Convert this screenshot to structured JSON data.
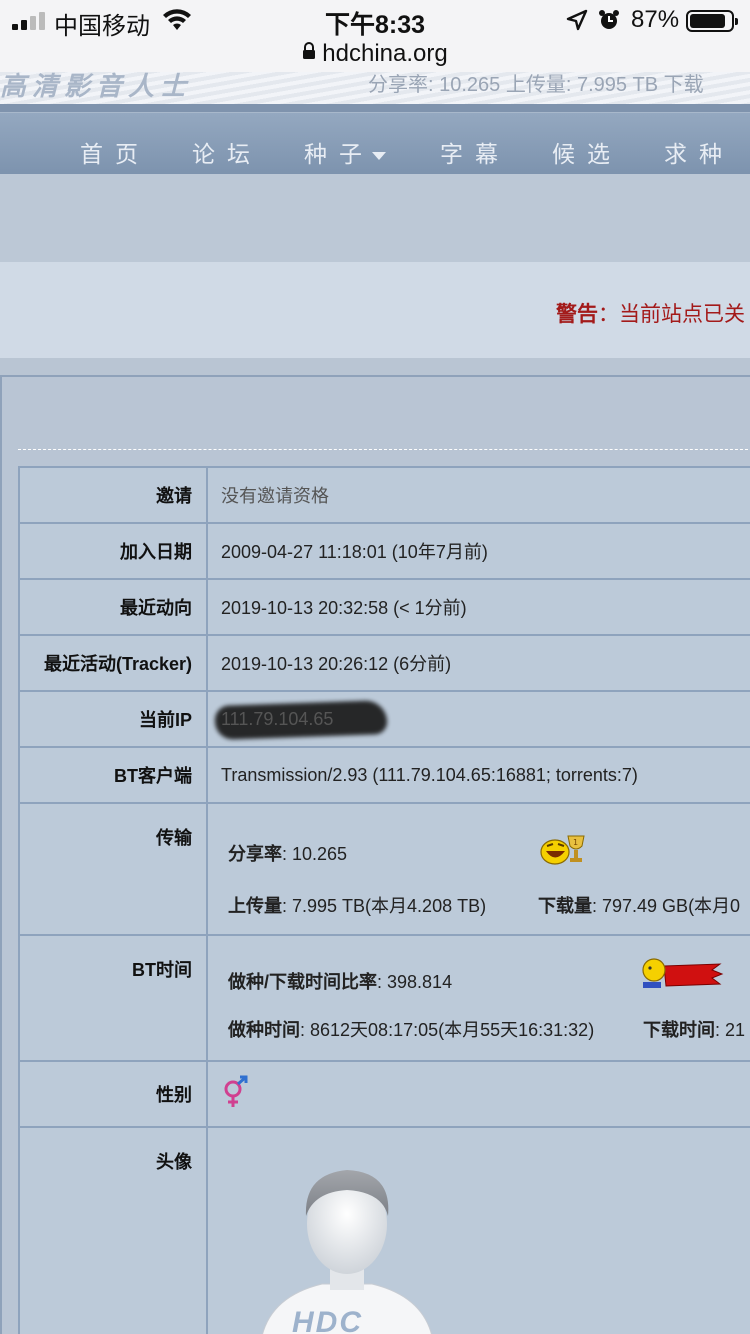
{
  "status_bar": {
    "carrier": "中国移动",
    "time": "下午8:33",
    "battery": "87%",
    "battery_level": 0.87
  },
  "browser": {
    "url": "hdchina.org"
  },
  "banner": {
    "logo_fragment": "高清影音人士",
    "stats_fragment": "分享率: 10.265    上传量: 7.995 TB    下载"
  },
  "nav": {
    "items": [
      {
        "label": "首页"
      },
      {
        "label": "论坛"
      },
      {
        "label": "种子",
        "has_dropdown": true
      },
      {
        "label": "字幕"
      },
      {
        "label": "候选"
      },
      {
        "label": "求种"
      }
    ]
  },
  "notice": {
    "prefix": "警告",
    "text": "：当前站点已关"
  },
  "profile": {
    "rows": [
      {
        "label": "邀请",
        "value": "没有邀请资格"
      },
      {
        "label": "加入日期",
        "value": "2009-04-27 11:18:01 (10年7月前)"
      },
      {
        "label": "最近动向",
        "value": "2019-10-13 20:32:58 (< 1分前)"
      },
      {
        "label": "最近活动(Tracker)",
        "value": "2019-10-13 20:26:12 (6分前)"
      },
      {
        "label": "当前IP",
        "value": "111.79.104.65"
      },
      {
        "label": "BT客户端",
        "value": "Transmission/2.93 (111.79.104.65:16881; torrents:7)"
      }
    ],
    "transfer": {
      "label": "传输",
      "ratio_label": "分享率",
      "ratio_value": ": 10.265",
      "upload_label": "上传量",
      "upload_value": ": 7.995 TB(本月4.208 TB)",
      "download_label": "下载量",
      "download_value": ": 797.49 GB(本月0"
    },
    "bt_time": {
      "label": "BT时间",
      "ratio_label": "做种/下载时间比率",
      "ratio_value": ": 398.814",
      "seed_label": "做种时间",
      "seed_value": ": 8612天08:17:05(本月55天16:31:32)",
      "dl_label": "下载时间",
      "dl_value": ": 21"
    },
    "gender": {
      "label": "性别"
    },
    "avatar": {
      "label": "头像",
      "shirt_text": "HDC"
    }
  }
}
